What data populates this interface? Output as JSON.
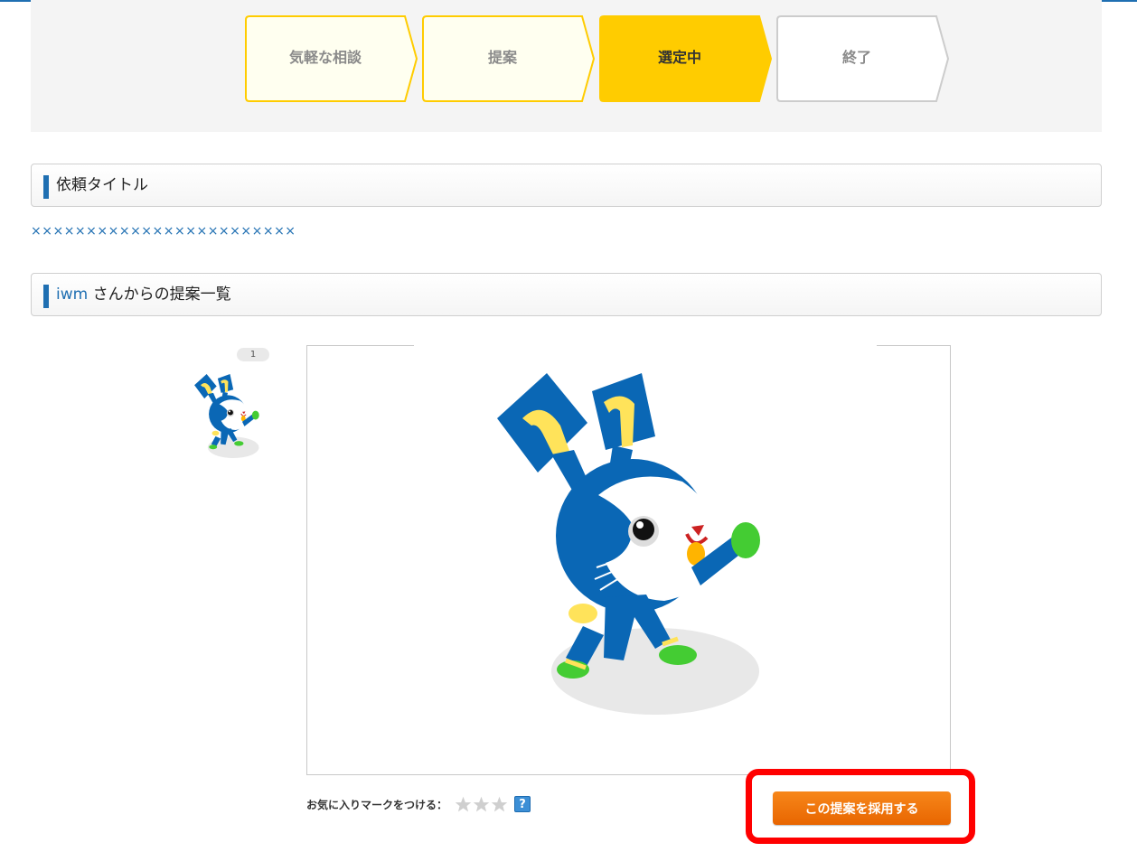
{
  "steps": [
    {
      "label": "気軽な相談",
      "state": "done"
    },
    {
      "label": "提案",
      "state": "done"
    },
    {
      "label": "選定中",
      "state": "current"
    },
    {
      "label": "終了",
      "state": "upcoming"
    }
  ],
  "request_section": {
    "heading": "依頼タイトル",
    "title_value": "××××××××××××××××××××××××"
  },
  "proposals_section": {
    "user": "iwm",
    "heading_suffix": " さんからの提案一覧"
  },
  "proposal": {
    "number": "1",
    "image_subject": "blue rabbit mascot character"
  },
  "favorite": {
    "label": "お気に入りマークをつける：",
    "stars_total": 3,
    "stars_selected": 0,
    "help_label": "?"
  },
  "actions": {
    "adopt_label": "この提案を採用する"
  },
  "colors": {
    "accent_blue": "#1f6fb2",
    "step_current": "#ffcc00",
    "step_done_border": "#ffcc00",
    "step_done_fill": "#fffff0",
    "button_orange": "#f07a0c",
    "highlight_red": "#ff0000"
  }
}
